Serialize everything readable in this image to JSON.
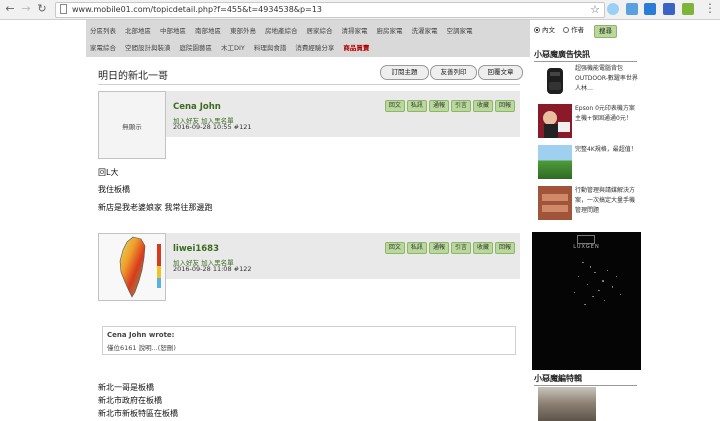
{
  "browser": {
    "url": "www.mobile01.com/topicdetail.php?f=455&t=4934538&p=13"
  },
  "categories": {
    "row1": [
      "分區列表",
      "北部地區",
      "中部地區",
      "南部地區",
      "東部外島",
      "房地產綜合",
      "居家綜合",
      "清掃家電",
      "廚房家電",
      "洗濯家電",
      "空調家電"
    ],
    "row2": [
      "家電綜合",
      "空間設計與裝潢",
      "庭院園藝區",
      "木工DIY",
      "料理與食譜",
      "消費經驗分享"
    ],
    "highlight": "商品買賣"
  },
  "topic": {
    "title": "明日的新北一哥",
    "buttons": [
      "訂閱主題",
      "友善列印",
      "回覆文章"
    ]
  },
  "posts": [
    {
      "avatar_text": "無顯示",
      "username": "Cena John",
      "links": "加入好友  加入黑名單",
      "date": "2016-09-28 10:55  #121",
      "actions": [
        "回文",
        "私訊",
        "通報",
        "引言",
        "收藏",
        "回報"
      ],
      "lines": [
        "回L大",
        "我住板橋",
        "新店是我老婆娘家  我常往那邊跑"
      ]
    },
    {
      "username": "liwei1683",
      "links": "加入好友  加入黑名單",
      "date": "2016-09-28 11:08  #122",
      "actions": [
        "回文",
        "私訊",
        "通報",
        "引言",
        "收藏",
        "回報"
      ],
      "quote_author": "Cena John wrote:",
      "quote_text": "僅位6161 說明...(恕刪)",
      "lines": [
        "新北一哥是板橋",
        "新北市政府在板橋",
        "新北市新板特區在板橋"
      ]
    }
  ],
  "sidebar": {
    "radio_labels": [
      "內文",
      "作者"
    ],
    "search_button": "搜尋",
    "ads_heading": "小惡魔廣告快訊",
    "ads": [
      {
        "text": "超强機能電腦背包 OUTDOOR-數躍率世界人林…"
      },
      {
        "text": "Epson 0元印表機方案 主機+保固通通0元！"
      },
      {
        "text": "完整4K規格，最超值！"
      },
      {
        "text": "行動管理與請媒解決方案，一次搞定大量手機管理問題"
      }
    ],
    "bigad_logo": "LUXGEN",
    "editor_heading": "小惡魔編特輯"
  }
}
